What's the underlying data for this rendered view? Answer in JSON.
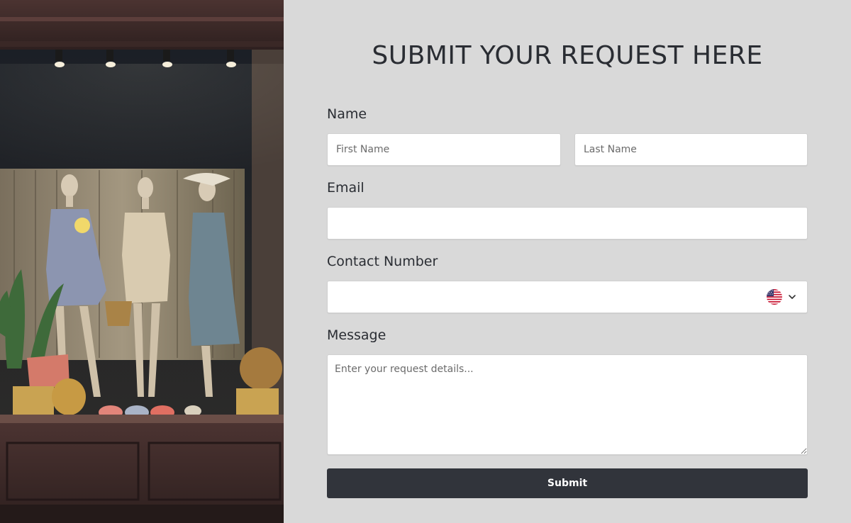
{
  "form": {
    "title": "SUBMIT YOUR REQUEST HERE",
    "name_label": "Name",
    "first_name_placeholder": "First Name",
    "last_name_placeholder": "Last Name",
    "email_label": "Email",
    "email_value": "",
    "contact_label": "Contact Number",
    "contact_value": "",
    "country_flag_icon": "us-flag-icon",
    "message_label": "Message",
    "message_placeholder": "Enter your request details...",
    "submit_label": "Submit"
  },
  "colors": {
    "background": "#d9d9d9",
    "text": "#2a2d33",
    "button": "#31343b",
    "button_text": "#ffffff"
  }
}
